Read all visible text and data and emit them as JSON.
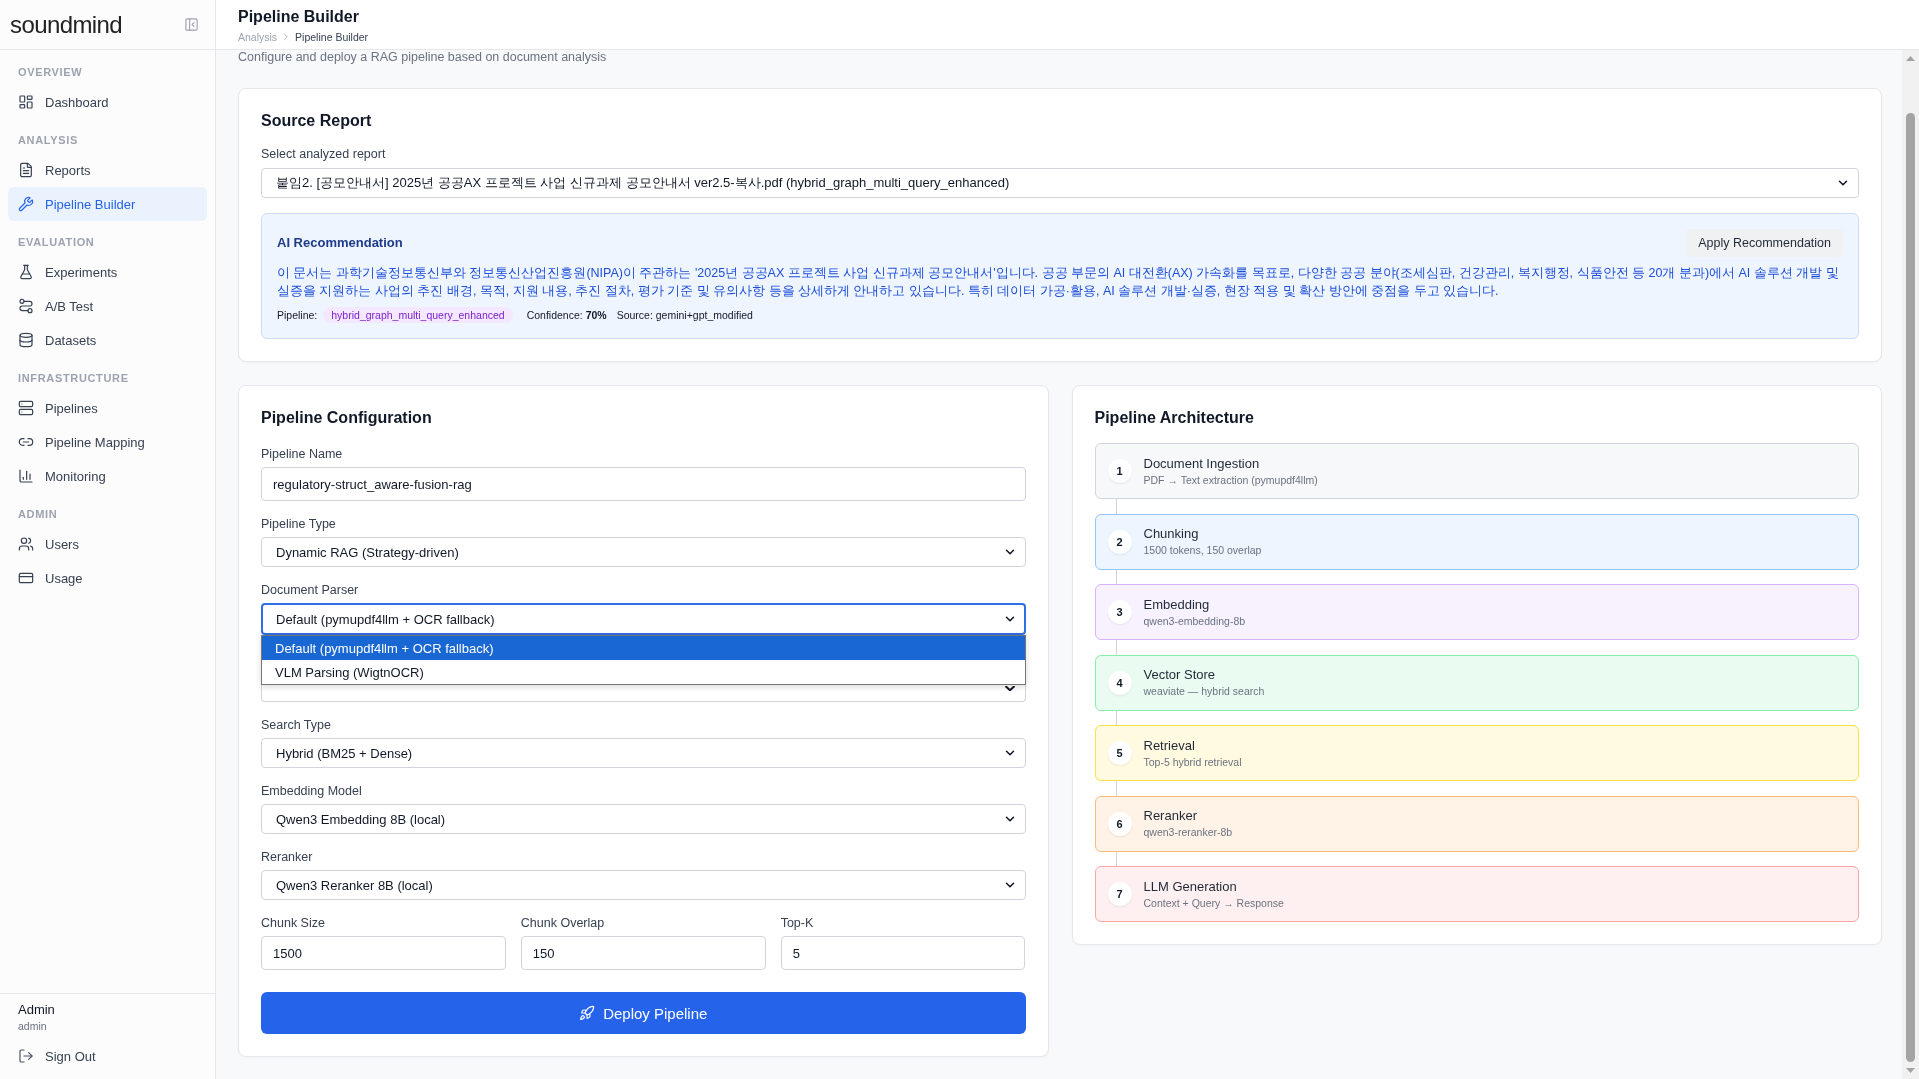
{
  "sidebar": {
    "logo": "soundmind",
    "sections": [
      {
        "title": "OVERVIEW",
        "items": [
          {
            "label": "Dashboard",
            "selected": false
          }
        ]
      },
      {
        "title": "ANALYSIS",
        "items": [
          {
            "label": "Reports",
            "selected": false
          },
          {
            "label": "Pipeline Builder",
            "selected": true
          }
        ]
      },
      {
        "title": "EVALUATION",
        "items": [
          {
            "label": "Experiments",
            "selected": false
          },
          {
            "label": "A/B Test",
            "selected": false
          },
          {
            "label": "Datasets",
            "selected": false
          }
        ]
      },
      {
        "title": "INFRASTRUCTURE",
        "items": [
          {
            "label": "Pipelines",
            "selected": false
          },
          {
            "label": "Pipeline Mapping",
            "selected": false
          },
          {
            "label": "Monitoring",
            "selected": false
          }
        ]
      },
      {
        "title": "ADMIN",
        "items": [
          {
            "label": "Users",
            "selected": false
          },
          {
            "label": "Usage",
            "selected": false
          }
        ]
      }
    ],
    "user": {
      "name": "Admin",
      "role": "admin"
    },
    "sign_out": "Sign Out"
  },
  "header": {
    "title": "Pipeline Builder",
    "breadcrumb": [
      "Analysis",
      "Pipeline Builder"
    ]
  },
  "subtitle": "Configure and deploy a RAG pipeline based on document analysis",
  "source_report": {
    "title": "Source Report",
    "label": "Select analyzed report",
    "value": "붙임2. [공모안내서] 2025년 공공AX 프로젝트 사업 신규과제 공모안내서 ver2.5-복사.pdf (hybrid_graph_multi_query_enhanced)",
    "recommendation": {
      "title": "AI Recommendation",
      "button": "Apply Recommendation",
      "text": "이 문서는 과학기술정보통신부와 정보통신산업진흥원(NIPA)이 주관하는 '2025년 공공AX 프로젝트 사업 신규과제 공모안내서'입니다. 공공 부문의 AI 대전환(AX) 가속화를 목표로, 다양한 공공 분야(조세심판, 건강관리, 복지행정, 식품안전 등 20개 분과)에서 AI 솔루션 개발 및 실증을 지원하는 사업의 추진 배경, 목적, 지원 내용, 추진 절차, 평가 기준 및 유의사항 등을 상세하게 안내하고 있습니다. 특히 데이터 가공·활용, AI 솔루션 개발·실증, 현장 적용 및 확산 방안에 중점을 두고 있습니다.",
      "pipeline_label": "Pipeline:",
      "pipeline": "hybrid_graph_multi_query_enhanced",
      "confidence": "Confidence: **70%**",
      "source": "Source: gemini+gpt_modified"
    }
  },
  "configuration": {
    "title": "Pipeline Configuration",
    "fields": [
      {
        "kind": "input",
        "label": "Pipeline Name",
        "value": "regulatory-struct_aware-fusion-rag",
        "focused": false
      },
      {
        "kind": "select",
        "label": "Pipeline Type",
        "value": "Dynamic RAG (Strategy-driven)",
        "focused": false
      },
      {
        "kind": "select",
        "label": "Document Parser",
        "value": "Default (pymupdf4llm + OCR fallback)",
        "focused": true,
        "options": [
          {
            "label": "Default (pymupdf4llm + OCR fallback)",
            "selected": true
          },
          {
            "label": "VLM Parsing (WigtnOCR)",
            "selected": false
          }
        ]
      },
      {
        "kind": "covered"
      },
      {
        "kind": "select",
        "label": "Search Type",
        "value": "Hybrid (BM25 + Dense)",
        "focused": false
      },
      {
        "kind": "select",
        "label": "Embedding Model",
        "value": "Qwen3 Embedding 8B (local)",
        "focused": false
      },
      {
        "kind": "select",
        "label": "Reranker",
        "value": "Qwen3 Reranker 8B (local)",
        "focused": false
      }
    ],
    "number_fields": [
      {
        "label": "Chunk Size",
        "value": "1500"
      },
      {
        "label": "Chunk Overlap",
        "value": "150"
      },
      {
        "label": "Top-K",
        "value": "5"
      }
    ],
    "deploy_button": "Deploy Pipeline"
  },
  "architecture": {
    "title": "Pipeline Architecture",
    "steps": [
      {
        "number": "1",
        "title": "Document Ingestion",
        "detail": "PDF → Text extraction (pymupdf4llm)",
        "color": "#d1d5db"
      },
      {
        "number": "2",
        "title": "Chunking",
        "detail": "1500 tokens, 150 overlap",
        "color": "#93c5fd"
      },
      {
        "number": "3",
        "title": "Embedding",
        "detail": "qwen3-embedding-8b",
        "color": "#d8b4fe"
      },
      {
        "number": "4",
        "title": "Vector Store",
        "detail": "weaviate — hybrid search",
        "color": "#86efac"
      },
      {
        "number": "5",
        "title": "Retrieval",
        "detail": "Top-5 hybrid retrieval",
        "color": "#fde047"
      },
      {
        "number": "6",
        "title": "Reranker",
        "detail": "qwen3-reranker-8b",
        "color": "#fdba74"
      },
      {
        "number": "7",
        "title": "LLM Generation",
        "detail": "Context + Query → Response",
        "color": "#fca5a5"
      }
    ]
  }
}
